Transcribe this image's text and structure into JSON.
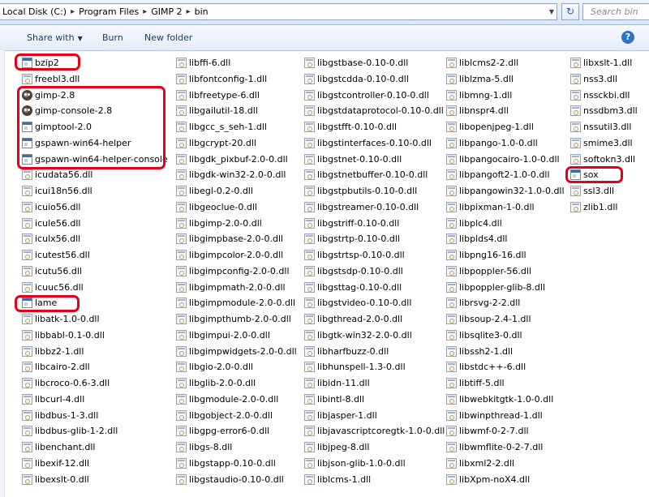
{
  "address": {
    "crumbs": [
      "Local Disk (C:)",
      "Program Files",
      "GIMP 2",
      "bin"
    ],
    "search_placeholder": "Search bin"
  },
  "toolbar": {
    "share_label": "Share with",
    "burn_label": "Burn",
    "new_folder_label": "New folder",
    "help_label": "?"
  },
  "files": {
    "col1": [
      {
        "name": "bzip2",
        "icon": "exe"
      },
      {
        "name": "freebl3.dll",
        "icon": "dll"
      },
      {
        "name": "gimp-2.8",
        "icon": "gimp"
      },
      {
        "name": "gimp-console-2.8",
        "icon": "gimp"
      },
      {
        "name": "gimptool-2.0",
        "icon": "exe"
      },
      {
        "name": "gspawn-win64-helper",
        "icon": "exe"
      },
      {
        "name": "gspawn-win64-helper-console",
        "icon": "exe"
      },
      {
        "name": "icudata56.dll",
        "icon": "dll"
      },
      {
        "name": "icui18n56.dll",
        "icon": "dll"
      },
      {
        "name": "icuio56.dll",
        "icon": "dll"
      },
      {
        "name": "icule56.dll",
        "icon": "dll"
      },
      {
        "name": "iculx56.dll",
        "icon": "dll"
      },
      {
        "name": "icutest56.dll",
        "icon": "dll"
      },
      {
        "name": "icutu56.dll",
        "icon": "dll"
      },
      {
        "name": "icuuc56.dll",
        "icon": "dll"
      },
      {
        "name": "lame",
        "icon": "exe"
      },
      {
        "name": "libatk-1.0-0.dll",
        "icon": "dll"
      },
      {
        "name": "libbabl-0.1-0.dll",
        "icon": "dll"
      },
      {
        "name": "libbz2-1.dll",
        "icon": "dll"
      },
      {
        "name": "libcairo-2.dll",
        "icon": "dll"
      },
      {
        "name": "libcroco-0.6-3.dll",
        "icon": "dll"
      },
      {
        "name": "libcurl-4.dll",
        "icon": "dll"
      },
      {
        "name": "libdbus-1-3.dll",
        "icon": "dll"
      },
      {
        "name": "libdbus-glib-1-2.dll",
        "icon": "dll"
      },
      {
        "name": "libenchant.dll",
        "icon": "dll"
      },
      {
        "name": "libexif-12.dll",
        "icon": "dll"
      },
      {
        "name": "libexslt-0.dll",
        "icon": "dll"
      }
    ],
    "col2": [
      {
        "name": "libffi-6.dll",
        "icon": "dll"
      },
      {
        "name": "libfontconfig-1.dll",
        "icon": "dll"
      },
      {
        "name": "libfreetype-6.dll",
        "icon": "dll"
      },
      {
        "name": "libgailutil-18.dll",
        "icon": "dll"
      },
      {
        "name": "libgcc_s_seh-1.dll",
        "icon": "dll"
      },
      {
        "name": "libgcrypt-20.dll",
        "icon": "dll"
      },
      {
        "name": "libgdk_pixbuf-2.0-0.dll",
        "icon": "dll"
      },
      {
        "name": "libgdk-win32-2.0-0.dll",
        "icon": "dll"
      },
      {
        "name": "libegl-0.2-0.dll",
        "icon": "dll"
      },
      {
        "name": "libgeoclue-0.dll",
        "icon": "dll"
      },
      {
        "name": "libgimp-2.0-0.dll",
        "icon": "dll"
      },
      {
        "name": "libgimpbase-2.0-0.dll",
        "icon": "dll"
      },
      {
        "name": "libgimpcolor-2.0-0.dll",
        "icon": "dll"
      },
      {
        "name": "libgimpconfig-2.0-0.dll",
        "icon": "dll"
      },
      {
        "name": "libgimpmath-2.0-0.dll",
        "icon": "dll"
      },
      {
        "name": "libgimpmodule-2.0-0.dll",
        "icon": "dll"
      },
      {
        "name": "libgimpthumb-2.0-0.dll",
        "icon": "dll"
      },
      {
        "name": "libgimpui-2.0-0.dll",
        "icon": "dll"
      },
      {
        "name": "libgimpwidgets-2.0-0.dll",
        "icon": "dll"
      },
      {
        "name": "libgio-2.0-0.dll",
        "icon": "dll"
      },
      {
        "name": "libglib-2.0-0.dll",
        "icon": "dll"
      },
      {
        "name": "libgmodule-2.0-0.dll",
        "icon": "dll"
      },
      {
        "name": "libgobject-2.0-0.dll",
        "icon": "dll"
      },
      {
        "name": "libgpg-error6-0.dll",
        "icon": "dll"
      },
      {
        "name": "libgs-8.dll",
        "icon": "dll"
      },
      {
        "name": "libgstapp-0.10-0.dll",
        "icon": "dll"
      },
      {
        "name": "libgstaudio-0.10-0.dll",
        "icon": "dll"
      }
    ],
    "col3": [
      {
        "name": "libgstbase-0.10-0.dll",
        "icon": "dll"
      },
      {
        "name": "libgstcdda-0.10-0.dll",
        "icon": "dll"
      },
      {
        "name": "libgstcontroller-0.10-0.dll",
        "icon": "dll"
      },
      {
        "name": "libgstdataprotocol-0.10-0.dll",
        "icon": "dll"
      },
      {
        "name": "libgstfft-0.10-0.dll",
        "icon": "dll"
      },
      {
        "name": "libgstinterfaces-0.10-0.dll",
        "icon": "dll"
      },
      {
        "name": "libgstnet-0.10-0.dll",
        "icon": "dll"
      },
      {
        "name": "libgstnetbuffer-0.10-0.dll",
        "icon": "dll"
      },
      {
        "name": "libgstpbutils-0.10-0.dll",
        "icon": "dll"
      },
      {
        "name": "libgstreamer-0.10-0.dll",
        "icon": "dll"
      },
      {
        "name": "libgstriff-0.10-0.dll",
        "icon": "dll"
      },
      {
        "name": "libgstrtp-0.10-0.dll",
        "icon": "dll"
      },
      {
        "name": "libgstrtsp-0.10-0.dll",
        "icon": "dll"
      },
      {
        "name": "libgstsdp-0.10-0.dll",
        "icon": "dll"
      },
      {
        "name": "libgsttag-0.10-0.dll",
        "icon": "dll"
      },
      {
        "name": "libgstvideo-0.10-0.dll",
        "icon": "dll"
      },
      {
        "name": "libgthread-2.0-0.dll",
        "icon": "dll"
      },
      {
        "name": "libgtk-win32-2.0-0.dll",
        "icon": "dll"
      },
      {
        "name": "libharfbuzz-0.dll",
        "icon": "dll"
      },
      {
        "name": "libhunspell-1.3-0.dll",
        "icon": "dll"
      },
      {
        "name": "libidn-11.dll",
        "icon": "dll"
      },
      {
        "name": "libintl-8.dll",
        "icon": "dll"
      },
      {
        "name": "libjasper-1.dll",
        "icon": "dll"
      },
      {
        "name": "libjavascriptcoregtk-1.0-0.dll",
        "icon": "dll"
      },
      {
        "name": "libjpeg-8.dll",
        "icon": "dll"
      },
      {
        "name": "libjson-glib-1.0-0.dll",
        "icon": "dll"
      },
      {
        "name": "liblcms-1.dll",
        "icon": "dll"
      }
    ],
    "col4": [
      {
        "name": "liblcms2-2.dll",
        "icon": "dll"
      },
      {
        "name": "liblzma-5.dll",
        "icon": "dll"
      },
      {
        "name": "libmng-1.dll",
        "icon": "dll"
      },
      {
        "name": "libnspr4.dll",
        "icon": "dll"
      },
      {
        "name": "libopenjpeg-1.dll",
        "icon": "dll"
      },
      {
        "name": "libpango-1.0-0.dll",
        "icon": "dll"
      },
      {
        "name": "libpangocairo-1.0-0.dll",
        "icon": "dll"
      },
      {
        "name": "libpangoft2-1.0-0.dll",
        "icon": "dll"
      },
      {
        "name": "libpangowin32-1.0-0.dll",
        "icon": "dll"
      },
      {
        "name": "libpixman-1-0.dll",
        "icon": "dll"
      },
      {
        "name": "libplc4.dll",
        "icon": "dll"
      },
      {
        "name": "libplds4.dll",
        "icon": "dll"
      },
      {
        "name": "libpng16-16.dll",
        "icon": "dll"
      },
      {
        "name": "libpoppler-56.dll",
        "icon": "dll"
      },
      {
        "name": "libpoppler-glib-8.dll",
        "icon": "dll"
      },
      {
        "name": "librsvg-2-2.dll",
        "icon": "dll"
      },
      {
        "name": "libsoup-2.4-1.dll",
        "icon": "dll"
      },
      {
        "name": "libsqlite3-0.dll",
        "icon": "dll"
      },
      {
        "name": "libssh2-1.dll",
        "icon": "dll"
      },
      {
        "name": "libstdc++-6.dll",
        "icon": "dll"
      },
      {
        "name": "libtiff-5.dll",
        "icon": "dll"
      },
      {
        "name": "libwebkitgtk-1.0-0.dll",
        "icon": "dll"
      },
      {
        "name": "libwinpthread-1.dll",
        "icon": "dll"
      },
      {
        "name": "libwmf-0-2-7.dll",
        "icon": "dll"
      },
      {
        "name": "libwmflite-0-2-7.dll",
        "icon": "dll"
      },
      {
        "name": "libxml2-2.dll",
        "icon": "dll"
      },
      {
        "name": "libXpm-noX4.dll",
        "icon": "dll"
      }
    ],
    "col5": [
      {
        "name": "libxslt-1.dll",
        "icon": "dll"
      },
      {
        "name": "nss3.dll",
        "icon": "dll"
      },
      {
        "name": "nssckbi.dll",
        "icon": "dll"
      },
      {
        "name": "nssdbm3.dll",
        "icon": "dll"
      },
      {
        "name": "nssutil3.dll",
        "icon": "dll"
      },
      {
        "name": "smime3.dll",
        "icon": "dll"
      },
      {
        "name": "softokn3.dll",
        "icon": "dll"
      },
      {
        "name": "sox",
        "icon": "exe"
      },
      {
        "name": "ssl3.dll",
        "icon": "dll"
      },
      {
        "name": "zlib1.dll",
        "icon": "dll"
      }
    ]
  },
  "colors": {
    "highlight": "#e3001b",
    "toolbar_text": "#1e395b"
  }
}
